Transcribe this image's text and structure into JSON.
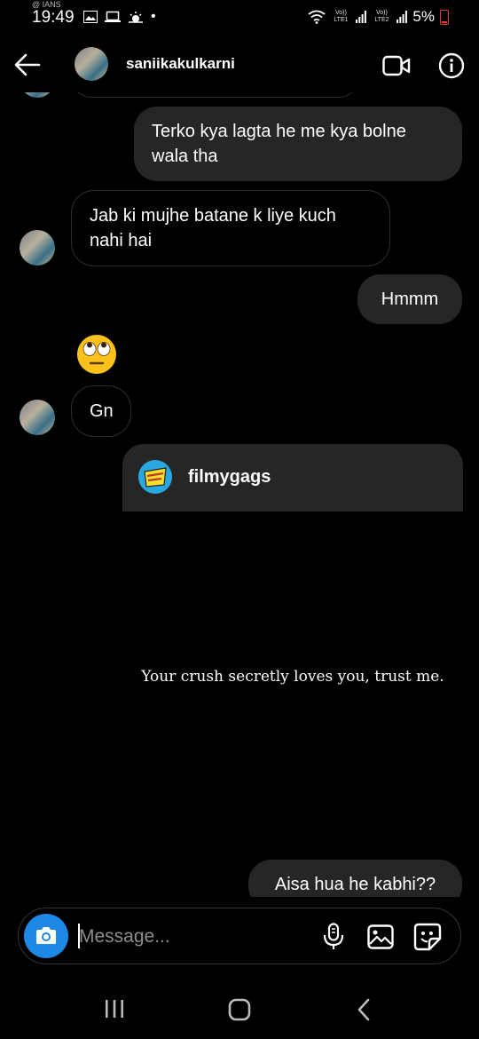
{
  "status_bar": {
    "carrier": "@ IANS",
    "time": "19:49",
    "sim1": "Vo)) LTE1",
    "sim2": "Vo)) LTE2",
    "battery": "5%",
    "battery_color": "#e53935"
  },
  "header": {
    "back_icon": "arrow-left-icon",
    "username": "saniikakulkarni",
    "video_icon": "video-camera-icon",
    "info_icon": "info-icon"
  },
  "messages": [
    {
      "from": "me",
      "text": "Terko kya lagta he me kya bolne wala tha"
    },
    {
      "from": "them",
      "text": "Jab ki mujhe batane k liye kuch nahi hai"
    },
    {
      "from": "me",
      "text": "Hmmm"
    },
    {
      "from": "them",
      "emoji": "face-with-rolling-eyes",
      "text": "🙄"
    },
    {
      "from": "them",
      "text": "Gn"
    },
    {
      "from": "me",
      "shared_post": {
        "account": "filmygags",
        "caption": "Your crush secretly loves you, trust me."
      }
    },
    {
      "from": "me",
      "text": "Aisa hua he kabhi??"
    }
  ],
  "composer": {
    "camera_icon": "camera-icon",
    "placeholder": "Message...",
    "mic_icon": "microphone-icon",
    "gallery_icon": "gallery-icon",
    "sticker_icon": "sticker-icon"
  },
  "colors": {
    "background": "#000000",
    "outgoing_bubble": "#262626",
    "accent": "#1e88e5"
  },
  "nav_bar": {
    "recents_icon": "recents-icon",
    "home_icon": "home-icon",
    "back_icon": "nav-back-icon"
  }
}
